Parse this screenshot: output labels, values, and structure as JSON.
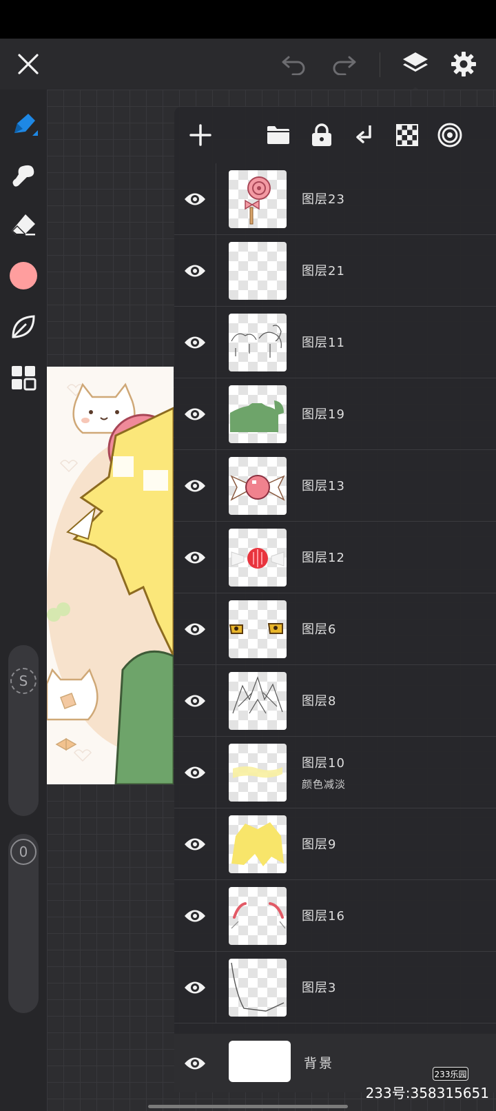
{
  "top_bar": {
    "close_icon": "close-icon",
    "undo_icon": "undo-icon",
    "redo_icon": "redo-icon",
    "layers_icon": "layers-icon",
    "settings_icon": "gear-icon"
  },
  "toolbar": {
    "tools": [
      "brush-icon",
      "smudge-icon",
      "eraser-icon",
      "color-swatch",
      "leaf-icon",
      "grid-icon"
    ],
    "color": "#ff9e9e",
    "size_badge": "S",
    "opacity_badge": "0"
  },
  "layer_panel": {
    "header_icons": [
      "add-layer-icon",
      "folder-icon",
      "lock-icon",
      "merge-down-icon",
      "checker-icon",
      "target-icon"
    ],
    "layers": [
      {
        "name": "图层23",
        "thumb": "lollipop"
      },
      {
        "name": "图层21",
        "thumb": "empty"
      },
      {
        "name": "图层11",
        "thumb": "sketch"
      },
      {
        "name": "图层19",
        "thumb": "green-shirt"
      },
      {
        "name": "图层13",
        "thumb": "candy"
      },
      {
        "name": "图层12",
        "thumb": "red-ball"
      },
      {
        "name": "图层6",
        "thumb": "eyes"
      },
      {
        "name": "图层8",
        "thumb": "hair-lines"
      },
      {
        "name": "图层10",
        "sub": "颜色减淡",
        "thumb": "yellow-strip"
      },
      {
        "name": "图层9",
        "thumb": "yellow-hair"
      },
      {
        "name": "图层16",
        "thumb": "pink-strokes"
      },
      {
        "name": "图层3",
        "thumb": "body-line"
      }
    ],
    "background_layer": "背景"
  },
  "watermark": {
    "logo": "233乐园",
    "text": "233号:358315651"
  }
}
